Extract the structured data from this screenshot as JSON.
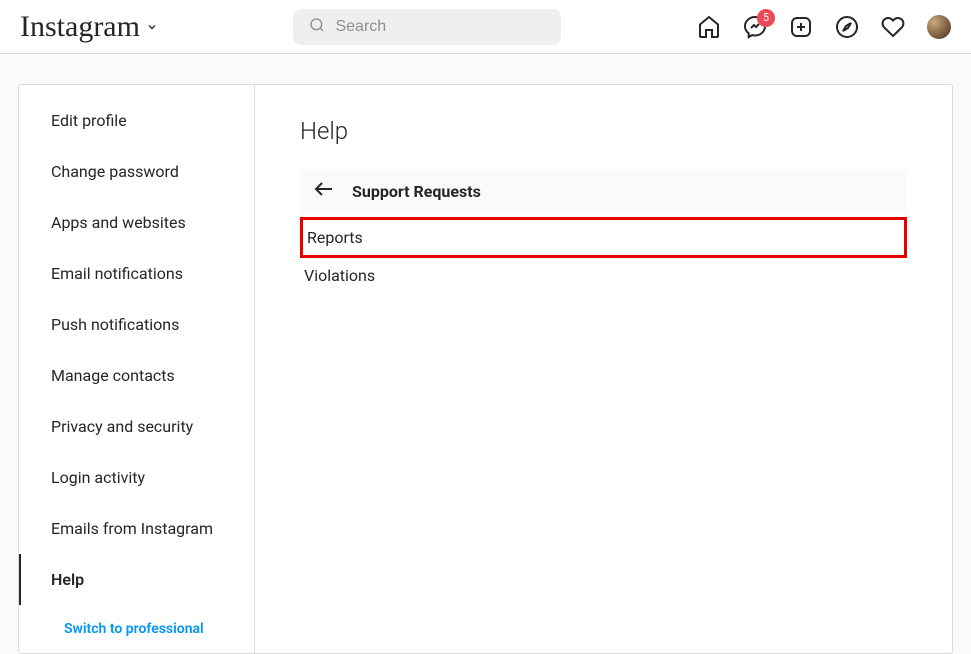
{
  "header": {
    "logo_text": "Instagram",
    "search_placeholder": "Search",
    "messenger_badge": "5"
  },
  "sidebar": {
    "items": [
      {
        "label": "Edit profile"
      },
      {
        "label": "Change password"
      },
      {
        "label": "Apps and websites"
      },
      {
        "label": "Email notifications"
      },
      {
        "label": "Push notifications"
      },
      {
        "label": "Manage contacts"
      },
      {
        "label": "Privacy and security"
      },
      {
        "label": "Login activity"
      },
      {
        "label": "Emails from Instagram"
      },
      {
        "label": "Help"
      }
    ],
    "switch_link": "Switch to professional"
  },
  "main": {
    "title": "Help",
    "support_header": "Support Requests",
    "rows": [
      {
        "label": "Reports"
      },
      {
        "label": "Violations"
      }
    ]
  }
}
